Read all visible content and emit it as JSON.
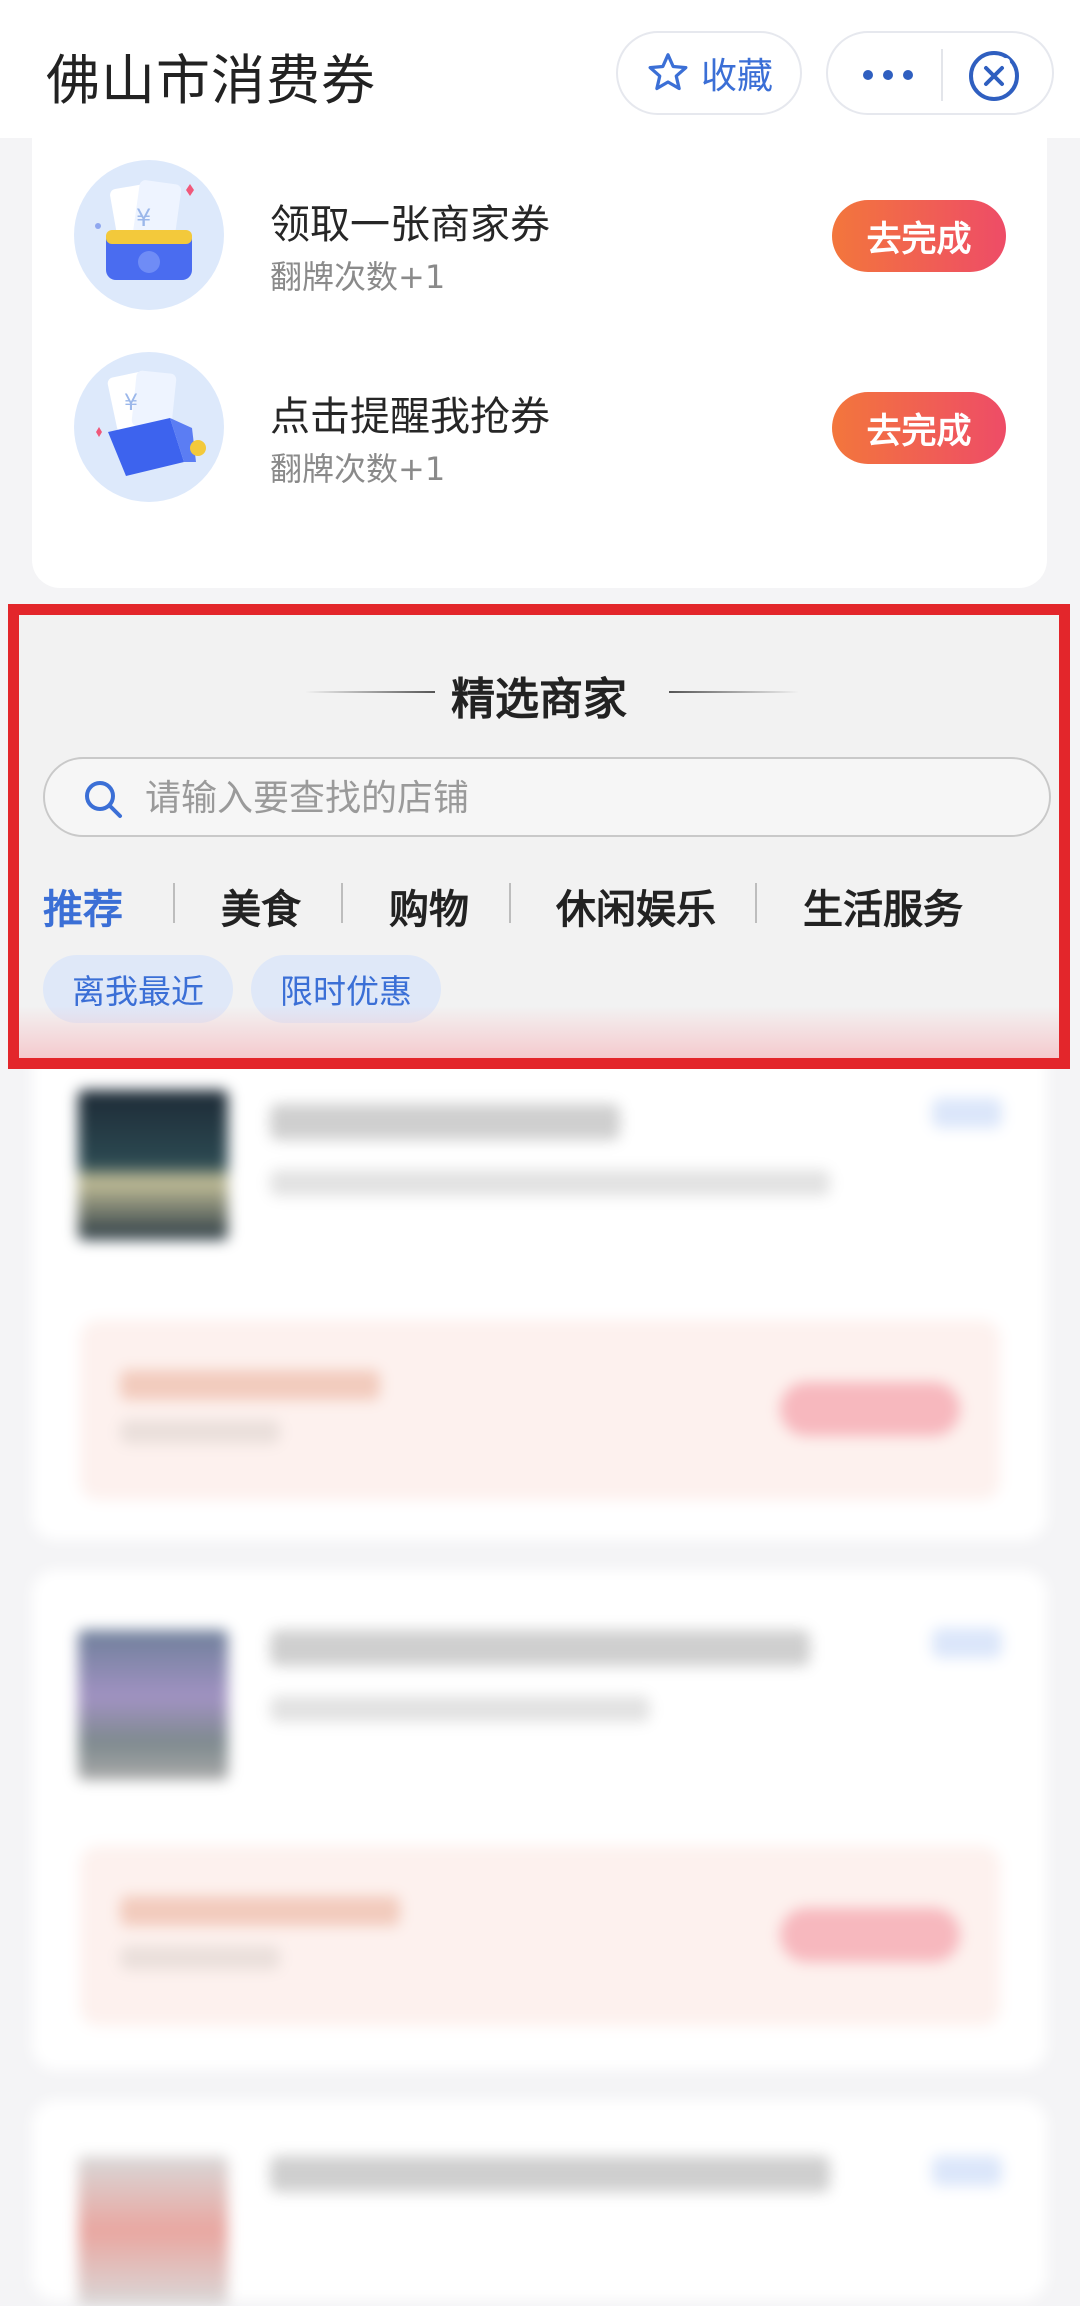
{
  "header": {
    "title": "佛山市消费券",
    "favorite_label": "收藏"
  },
  "tasks": [
    {
      "title": "领取一张商家券",
      "subtitle": "翻牌次数+1",
      "button": "去完成",
      "icon": "wallet-coupon-icon"
    },
    {
      "title": "点击提醒我抢券",
      "subtitle": "翻牌次数+1",
      "button": "去完成",
      "icon": "bell-coupon-icon"
    }
  ],
  "merchants": {
    "section_title": "精选商家",
    "search_placeholder": "请输入要查找的店铺",
    "categories": [
      "推荐",
      "美食",
      "购物",
      "休闲娱乐",
      "生活服务"
    ],
    "active_category": "推荐",
    "filters": [
      "离我最近",
      "限时优惠"
    ]
  },
  "colors": {
    "accent": "#3b6fd6",
    "button_gradient_start": "#f3763c",
    "button_gradient_end": "#ee4c67",
    "highlight_border": "#e3262b"
  }
}
